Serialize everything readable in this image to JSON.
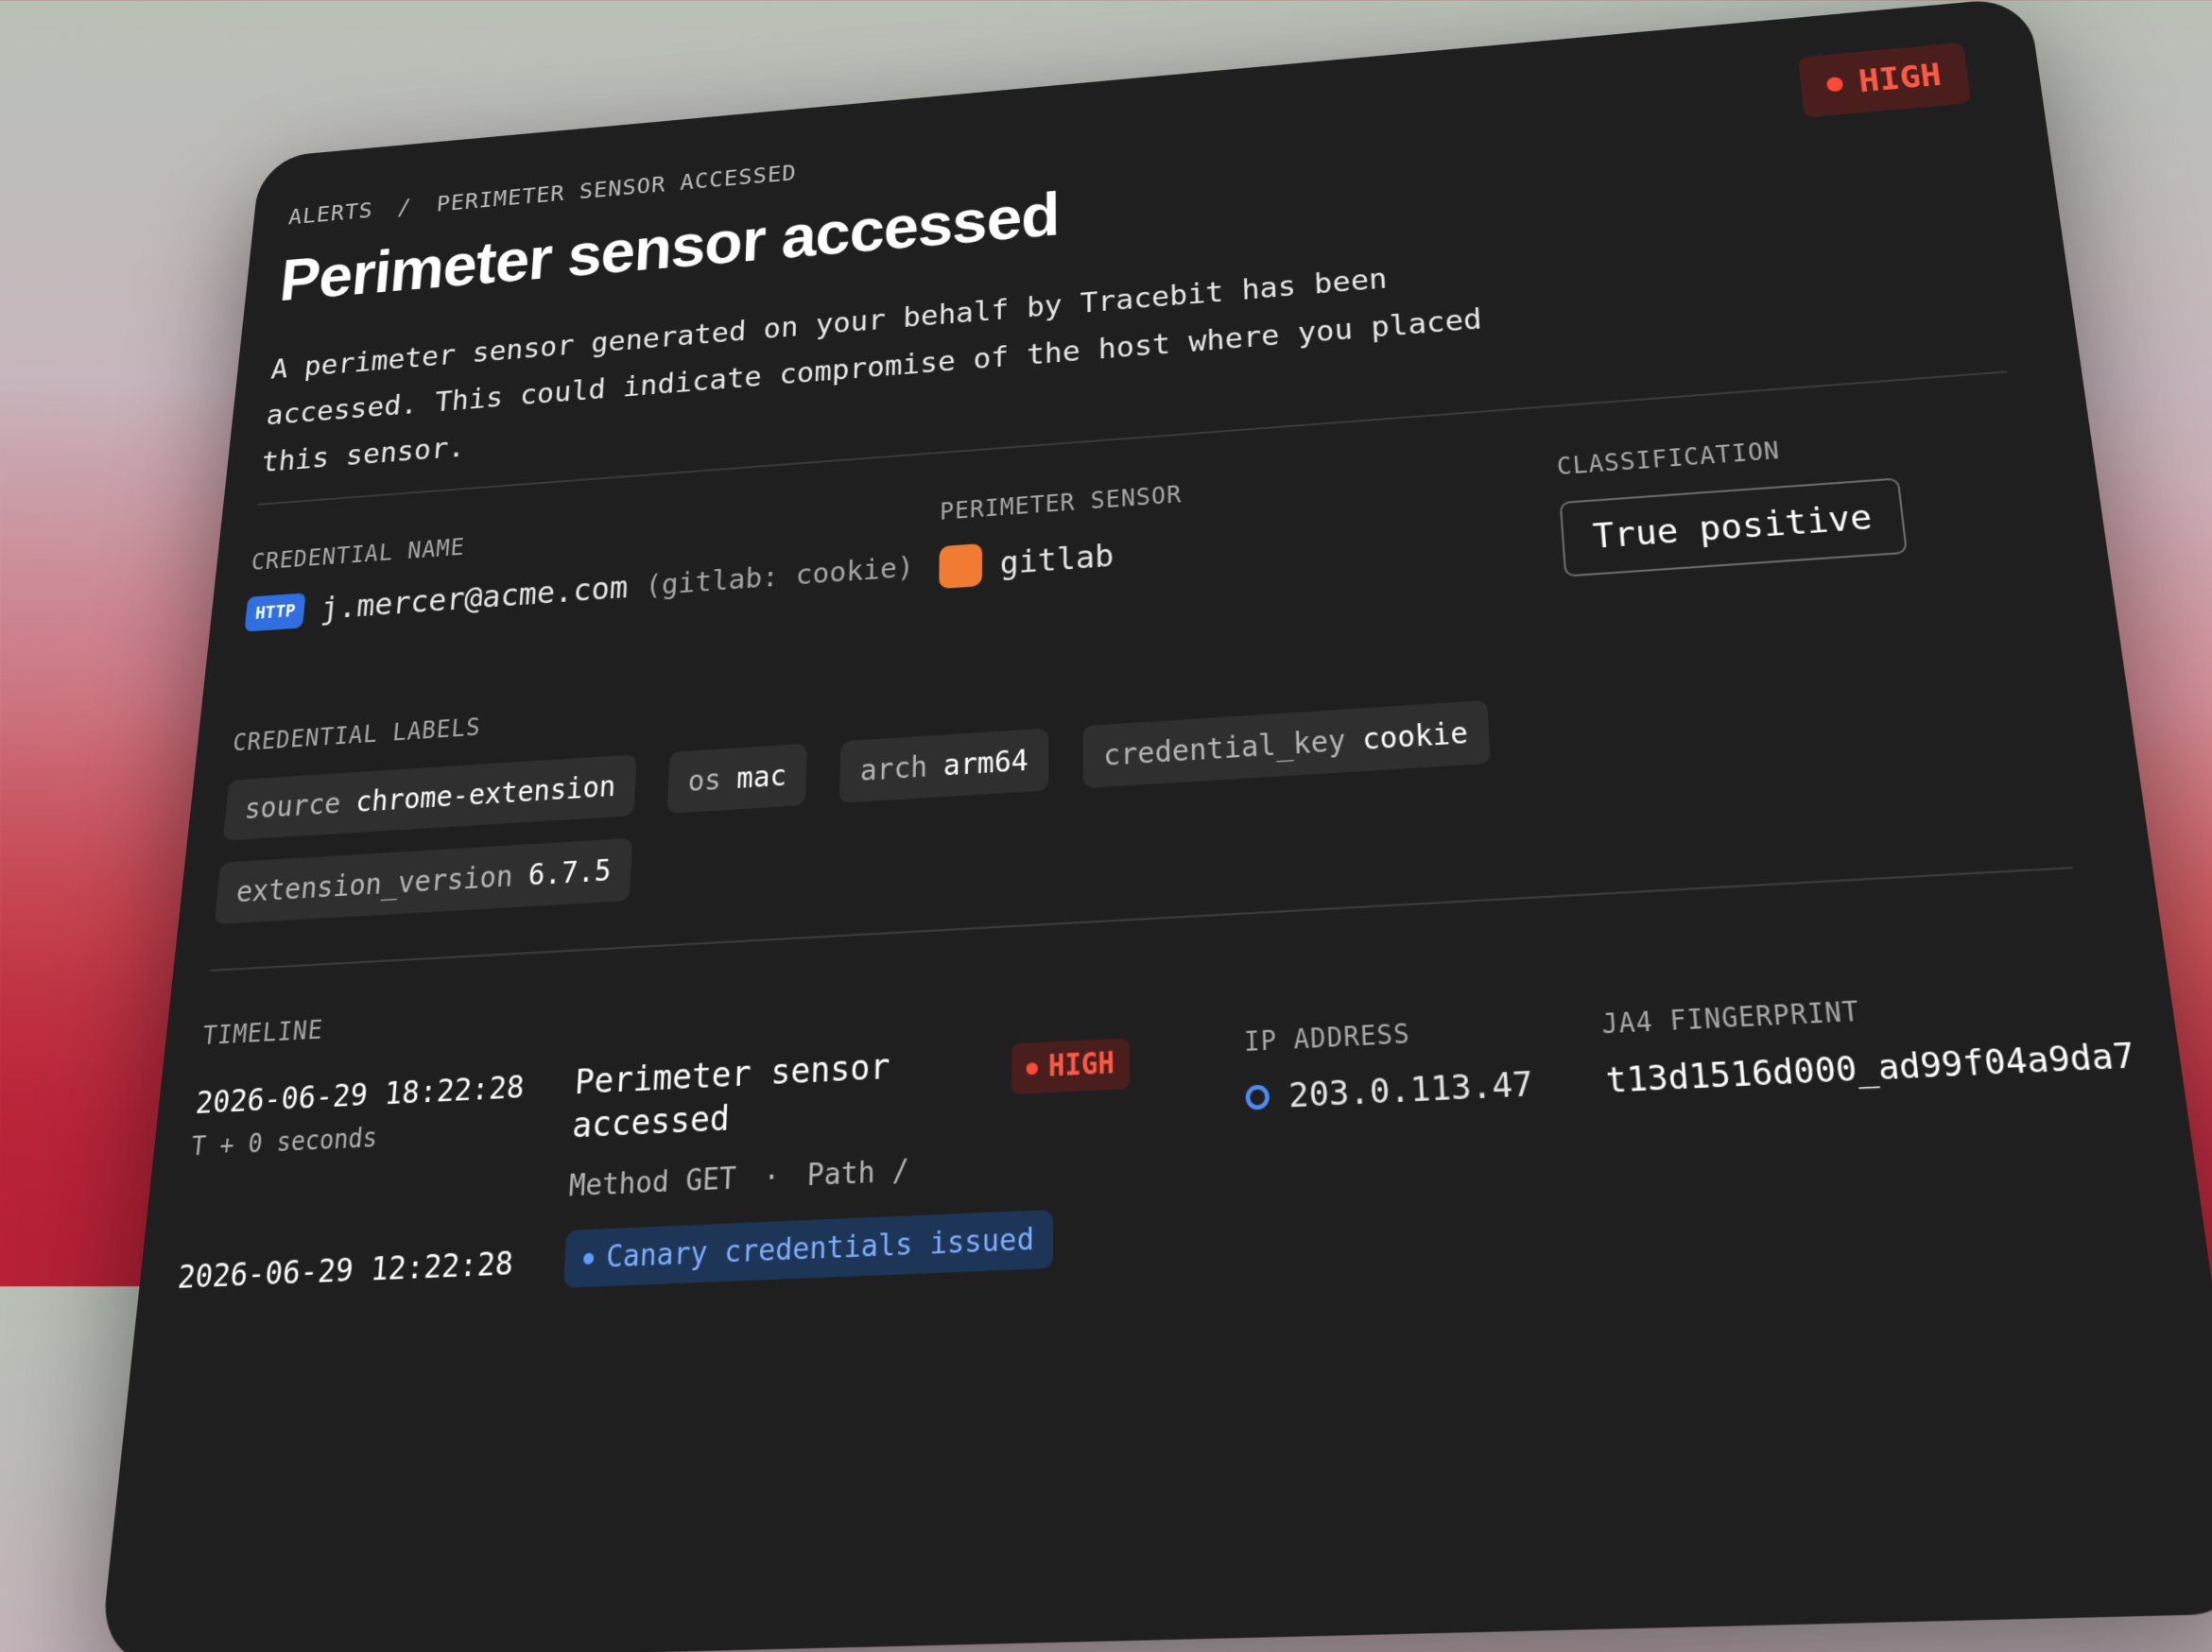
{
  "breadcrumb": {
    "root": "ALERTS",
    "separator": "/",
    "current": "PERIMETER SENSOR ACCESSED"
  },
  "severity": {
    "label": "HIGH",
    "color": "#ff5a45"
  },
  "title": "Perimeter sensor accessed",
  "description": "A perimeter sensor generated on your behalf by Tracebit has been accessed. This could indicate compromise of the host where you placed this sensor.",
  "credential": {
    "heading": "CREDENTIAL NAME",
    "type_badge": "HTTP",
    "name": "j.mercer@acme.com",
    "suffix": "(gitlab: cookie)"
  },
  "sensor": {
    "heading": "PERIMETER SENSOR",
    "icon": "gitlab-square-icon",
    "name": "gitlab",
    "icon_color": "#f07b32"
  },
  "classification": {
    "heading": "CLASSIFICATION",
    "value": "True positive"
  },
  "labels": {
    "heading": "CREDENTIAL LABELS",
    "items": [
      {
        "key": "source",
        "value": "chrome-extension"
      },
      {
        "key": "os",
        "value": "mac"
      },
      {
        "key": "arch",
        "value": "arm64"
      },
      {
        "key": "credential_key",
        "value": "cookie"
      },
      {
        "key": "extension_version",
        "value": "6.7.5"
      }
    ]
  },
  "timeline": {
    "heading": "TIMELINE",
    "events": [
      {
        "time": "2026-06-29 18:22:28",
        "relative": "T + 0 seconds",
        "event": "Perimeter sensor accessed",
        "severity": "HIGH",
        "method": "Method GET",
        "separator": "·",
        "path": "Path /",
        "ip_heading": "IP ADDRESS",
        "ip": "203.0.113.47",
        "ja4_heading": "JA4 FINGERPRINT",
        "ja4": "t13d1516d000_ad99f04a9da7"
      },
      {
        "time": "2026-06-29 12:22:28",
        "event": "Canary credentials issued"
      }
    ]
  }
}
